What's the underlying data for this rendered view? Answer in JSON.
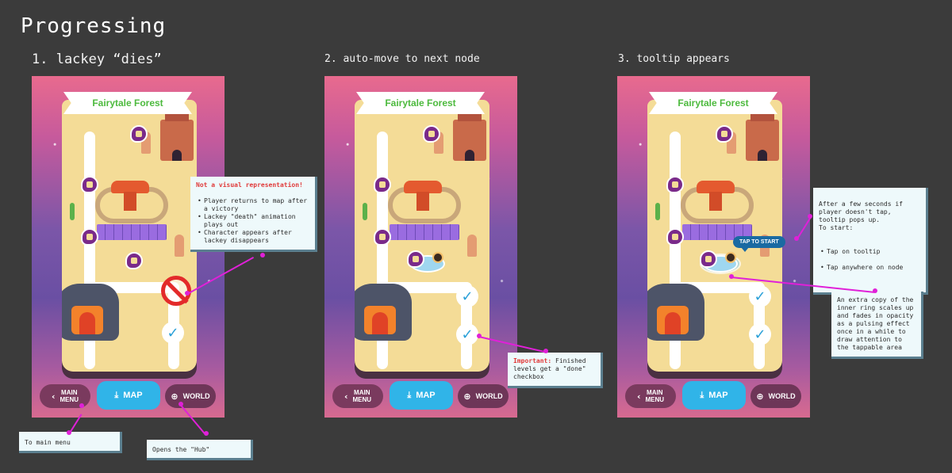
{
  "page_title": "Progressing",
  "steps": [
    {
      "title": "1. lackey “dies”"
    },
    {
      "title": "2. auto-move to next node"
    },
    {
      "title": "3. tooltip appears"
    }
  ],
  "map": {
    "title": "Fairytale Forest",
    "nav": {
      "main_menu": "MAIN\nMENU",
      "map": "MAP",
      "world": "WORLD"
    }
  },
  "notes": {
    "not_visual_heading": "Not a visual representation!",
    "not_visual_items": [
      "Player returns to map after a victory",
      "Lackey \"death\" animation plays out",
      "Character appears after lackey disappears"
    ],
    "main_menu_note": "To main menu",
    "hub_note": "Opens the \"Hub\"",
    "important_label": "Important:",
    "important_text": "Finished levels get a \"done\" checkbox",
    "tooltip_note": "After a few seconds if player doesn't tap, tooltip pops up.\nTo start:",
    "tooltip_items": [
      "Tap on tooltip",
      "Tap anywhere on node"
    ],
    "pulse_note": "An extra copy of the inner ring scales up and fades in opacity as a pulsing effect once in a while to draw attention to the tappable area"
  },
  "tooltip_label": "TAP TO START",
  "icons": {
    "back": "chevron-left-icon",
    "map": "map-download-icon",
    "world": "globe-icon",
    "check": "checkmark-icon"
  },
  "colors": {
    "accent_pink": "#e020d8",
    "map_button": "#30b4e8",
    "ribbon_text": "#4dba3e",
    "danger": "#e32a2a"
  }
}
